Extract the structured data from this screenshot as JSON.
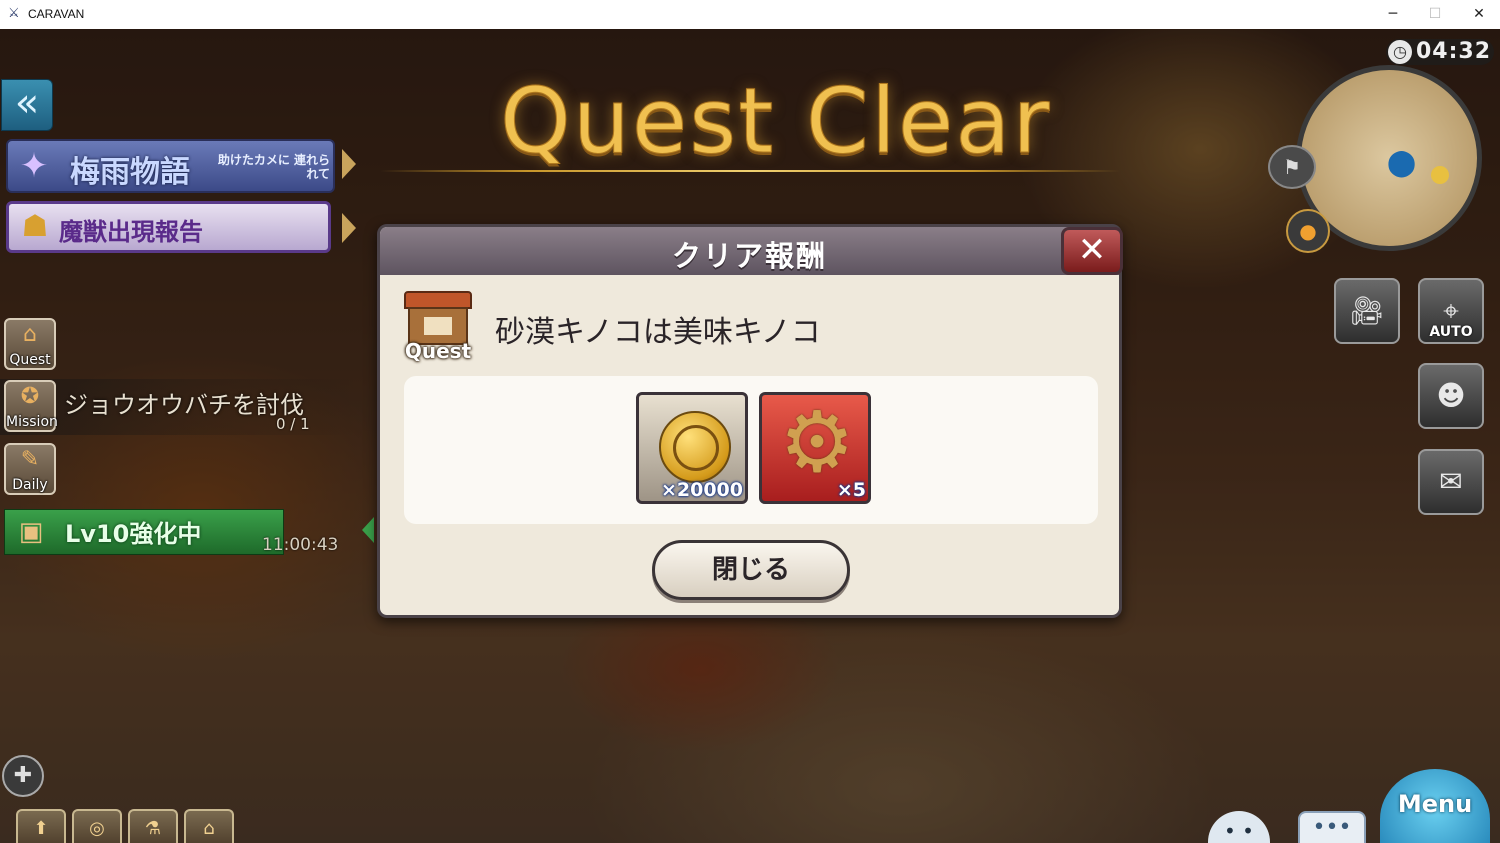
{
  "window": {
    "title": "CARAVAN",
    "app_icon": "caravan-app-icon",
    "minimize": "─",
    "maximize": "☐",
    "close": "✕"
  },
  "header": {
    "quest_clear": "Quest Clear"
  },
  "hud": {
    "timer": "04:32",
    "back_icon": "«",
    "banners": [
      {
        "title": "梅雨物語",
        "subtitle": "助けたカメに 連れられて",
        "icon": "star-icon"
      },
      {
        "title": "魔獣出現報告",
        "icon": "beast-mask-icon"
      }
    ],
    "side_buttons": [
      {
        "label": "Quest",
        "icon": "quest-house-icon"
      },
      {
        "label": "Mission",
        "icon": "mission-bird-icon"
      },
      {
        "label": "Daily",
        "icon": "daily-book-icon"
      }
    ],
    "mission": {
      "text": "ジョウオウバチを討伐",
      "progress": "0 / 1"
    },
    "upgrade": {
      "label": "Lv10強化中",
      "time": "11:00:43",
      "icon": "chest-icon"
    },
    "right_buttons": [
      {
        "name": "camera-button",
        "icon": "camera-icon",
        "label": ""
      },
      {
        "name": "auto-button",
        "icon": "auto-target-icon",
        "label": "AUTO"
      },
      {
        "name": "party-button",
        "icon": "group-icon",
        "label": ""
      },
      {
        "name": "mail-button",
        "icon": "mail-group-icon",
        "label": ""
      }
    ],
    "menu_label": "Menu"
  },
  "dialog": {
    "title": "クリア報酬",
    "close_icon": "close-icon",
    "quest_icon_label": "Quest",
    "quest_name": "砂漠キノコは美味キノコ",
    "rewards": [
      {
        "type": "gold-coin",
        "qty": "×20000"
      },
      {
        "type": "gear-material",
        "qty": "×5"
      }
    ],
    "close_button": "閉じる"
  },
  "colors": {
    "title_gold": "#f0c050",
    "dialog_bg": "#efe9dc",
    "header_bg": "#6e6470",
    "upgrade_green": "#3aa04a"
  }
}
